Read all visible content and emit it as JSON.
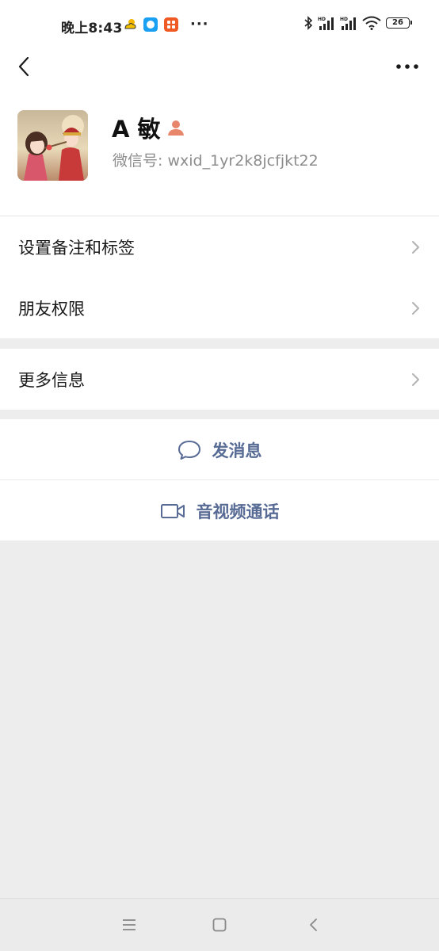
{
  "status_bar": {
    "time": "晚上8:43",
    "more": "···",
    "battery": "26",
    "network_labels": [
      "HD",
      "HD"
    ]
  },
  "header": {
    "back_icon": "chevron-left-icon",
    "more_icon": "more-dots-icon"
  },
  "profile": {
    "name": "A 敏",
    "gender_icon": "female-person-icon",
    "gender_color": "#e8866b",
    "wxid_label": "微信号:",
    "wxid_value": "wxid_1yr2k8jcfjkt22"
  },
  "menu": {
    "group1": [
      {
        "label": "设置备注和标签"
      },
      {
        "label": "朋友权限"
      }
    ],
    "group2": [
      {
        "label": "更多信息"
      }
    ]
  },
  "actions": {
    "send_message": "发消息",
    "video_call": "音视频通话",
    "accent_color": "#576b95"
  },
  "bottom_nav": {
    "icons": [
      "menu-icon",
      "home-square-icon",
      "back-triangle-icon"
    ]
  }
}
